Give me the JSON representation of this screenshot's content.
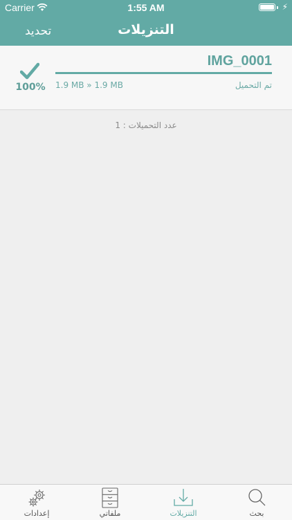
{
  "status_bar": {
    "carrier": "Carrier",
    "time": "1:55 AM"
  },
  "nav": {
    "refresh_label": "تحديد",
    "title": "التنزيلات"
  },
  "download": {
    "file_name": "IMG_0001",
    "status": "تم التحميل",
    "size": "1.9 MB » 1.9 MB",
    "percent": "100%",
    "progress": 1.0
  },
  "downloads_count": "عدد التحميلات : 1",
  "tabs": [
    {
      "label": "إعدادات",
      "icon": "gear-icon"
    },
    {
      "label": "ملفاتي",
      "icon": "cabinet-icon"
    },
    {
      "label": "التنزيلات",
      "icon": "download-icon",
      "active": true
    },
    {
      "label": "بحث",
      "icon": "search-icon"
    }
  ],
  "colors": {
    "accent": "#62aaa5",
    "background": "#efefef"
  }
}
